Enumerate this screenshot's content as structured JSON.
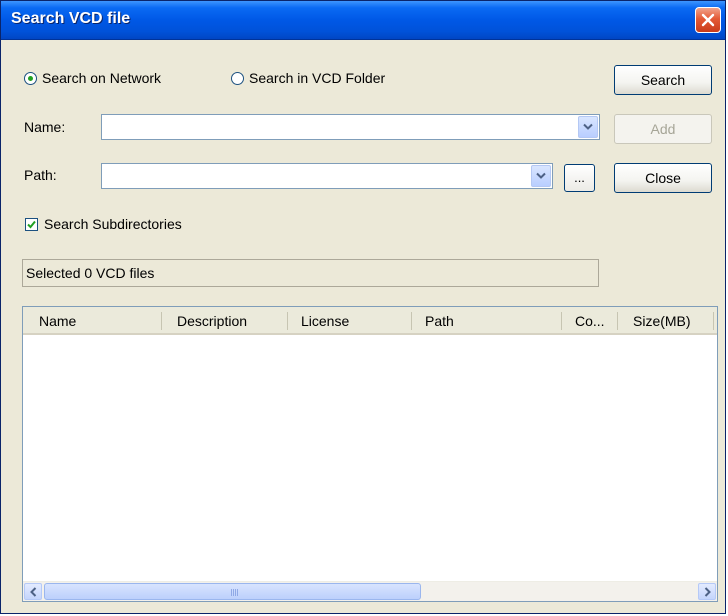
{
  "window": {
    "title": "Search VCD file"
  },
  "search_mode": {
    "option_network": "Search on Network",
    "option_folder": "Search in VCD Folder",
    "selected": "network"
  },
  "buttons": {
    "search": "Search",
    "add": "Add",
    "close": "Close",
    "browse": "..."
  },
  "name_field": {
    "label": "Name:",
    "value": ""
  },
  "path_field": {
    "label": "Path:",
    "value": ""
  },
  "subdirectories": {
    "label": "Search Subdirectories",
    "checked": true
  },
  "status": {
    "text": "Selected 0 VCD files"
  },
  "list": {
    "columns": [
      "Name",
      "Description",
      "License",
      "Path",
      "Co...",
      "Size(MB)"
    ],
    "rows": []
  },
  "icons": {
    "close": "close-icon",
    "dropdown": "chevron-down-icon",
    "scroll_left": "arrow-left-icon",
    "scroll_right": "arrow-right-icon",
    "check": "check-icon"
  },
  "colors": {
    "titlebar": "#0058e6",
    "close_button": "#e45a36",
    "window_bg": "#ece9d8",
    "radio_dot": "#21a121",
    "checkmark": "#21a121"
  }
}
